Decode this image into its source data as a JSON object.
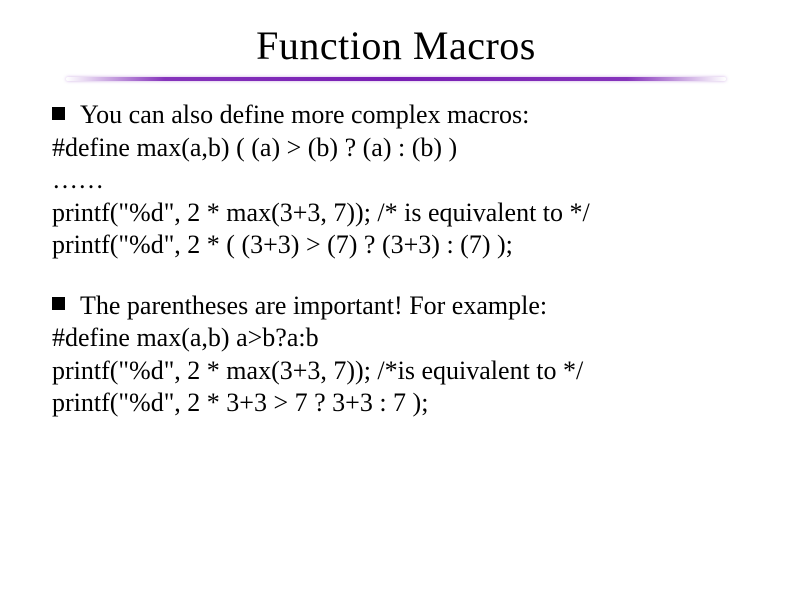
{
  "slide": {
    "title": "Function Macros",
    "block1": {
      "lead": "You can also define more complex macros:",
      "l1": "#define max(a,b)  ( (a) > (b) ? (a) : (b) )",
      "l2": "……",
      "l3": "printf(\"%d\", 2 * max(3+3, 7));  /* is equivalent to */",
      "l4": "printf(\"%d\", 2 * ( (3+3) > (7) ? (3+3) : (7) );"
    },
    "block2": {
      "lead": "The parentheses are important!  For example:",
      "l1": "#define max(a,b)  a>b?a:b",
      "l2": "printf(\"%d\", 2 * max(3+3, 7));  /*is equivalent to */",
      "l3": "printf(\"%d\", 2 * 3+3 > 7 ? 3+3 : 7 );"
    }
  }
}
